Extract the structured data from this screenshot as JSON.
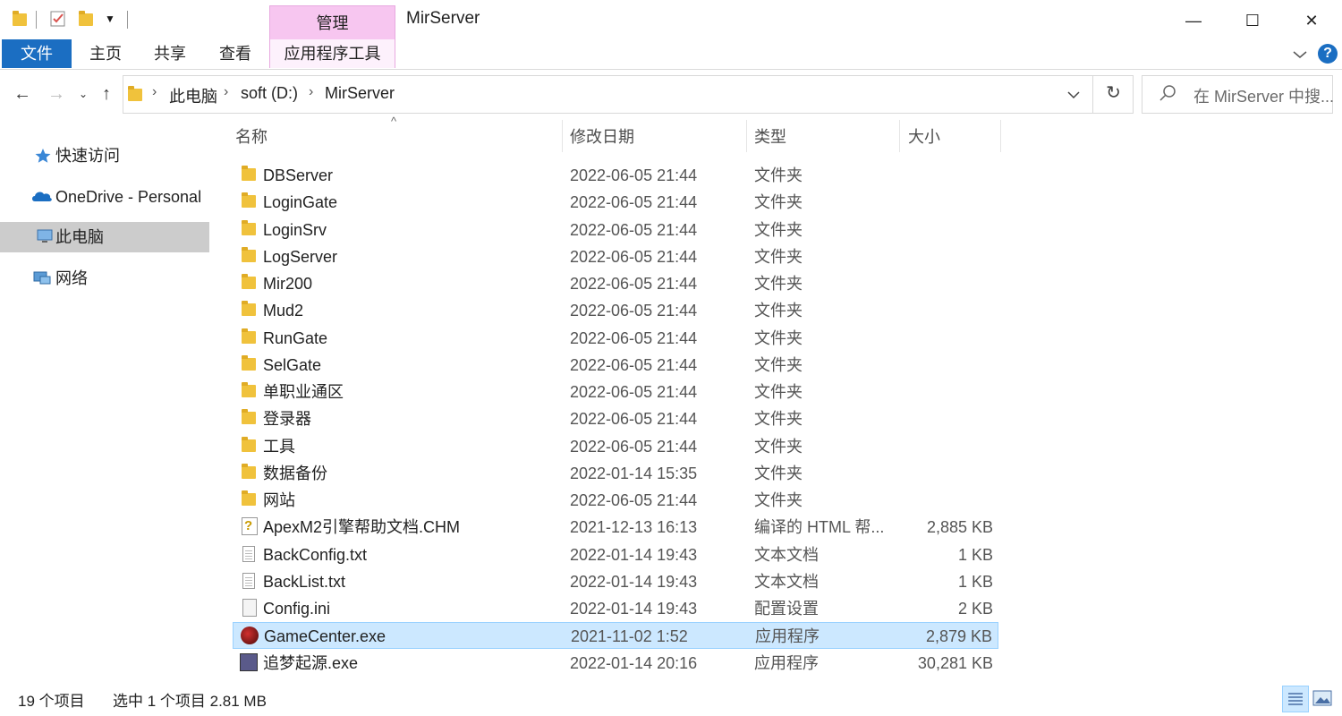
{
  "window": {
    "title": "MirServer",
    "manage_tab": "管理",
    "minimize": "—",
    "maximize": "☐",
    "close": "✕"
  },
  "ribbon": {
    "tabs": [
      "文件",
      "主页",
      "共享",
      "查看",
      "应用程序工具"
    ],
    "help": "?"
  },
  "address": {
    "crumbs": [
      "此电脑",
      "soft (D:)",
      "MirServer"
    ],
    "search_placeholder": "在 MirServer 中搜..."
  },
  "nav_pane": {
    "items": [
      "快速访问",
      "OneDrive - Personal",
      "此电脑",
      "网络"
    ],
    "selected_index": 2
  },
  "columns": {
    "name": "名称",
    "date": "修改日期",
    "type": "类型",
    "size": "大小"
  },
  "files": [
    {
      "name": "DBServer",
      "date": "2022-06-05 21:44",
      "type": "文件夹",
      "size": "",
      "icon": "folder-icon"
    },
    {
      "name": "LoginGate",
      "date": "2022-06-05 21:44",
      "type": "文件夹",
      "size": "",
      "icon": "folder-icon"
    },
    {
      "name": "LoginSrv",
      "date": "2022-06-05 21:44",
      "type": "文件夹",
      "size": "",
      "icon": "folder-icon"
    },
    {
      "name": "LogServer",
      "date": "2022-06-05 21:44",
      "type": "文件夹",
      "size": "",
      "icon": "folder-icon"
    },
    {
      "name": "Mir200",
      "date": "2022-06-05 21:44",
      "type": "文件夹",
      "size": "",
      "icon": "folder-icon"
    },
    {
      "name": "Mud2",
      "date": "2022-06-05 21:44",
      "type": "文件夹",
      "size": "",
      "icon": "folder-icon"
    },
    {
      "name": "RunGate",
      "date": "2022-06-05 21:44",
      "type": "文件夹",
      "size": "",
      "icon": "folder-icon"
    },
    {
      "name": "SelGate",
      "date": "2022-06-05 21:44",
      "type": "文件夹",
      "size": "",
      "icon": "folder-icon"
    },
    {
      "name": "单职业通区",
      "date": "2022-06-05 21:44",
      "type": "文件夹",
      "size": "",
      "icon": "folder-icon"
    },
    {
      "name": "登录器",
      "date": "2022-06-05 21:44",
      "type": "文件夹",
      "size": "",
      "icon": "folder-icon"
    },
    {
      "name": "工具",
      "date": "2022-06-05 21:44",
      "type": "文件夹",
      "size": "",
      "icon": "folder-icon"
    },
    {
      "name": "数据备份",
      "date": "2022-01-14 15:35",
      "type": "文件夹",
      "size": "",
      "icon": "folder-icon"
    },
    {
      "name": "网站",
      "date": "2022-06-05 21:44",
      "type": "文件夹",
      "size": "",
      "icon": "folder-icon"
    },
    {
      "name": "ApexM2引擎帮助文档.CHM",
      "date": "2021-12-13 16:13",
      "type": "编译的 HTML 帮...",
      "size": "2,885 KB",
      "icon": "chm-icon"
    },
    {
      "name": "BackConfig.txt",
      "date": "2022-01-14 19:43",
      "type": "文本文档",
      "size": "1 KB",
      "icon": "text-file-icon"
    },
    {
      "name": "BackList.txt",
      "date": "2022-01-14 19:43",
      "type": "文本文档",
      "size": "1 KB",
      "icon": "text-file-icon"
    },
    {
      "name": "Config.ini",
      "date": "2022-01-14 19:43",
      "type": "配置设置",
      "size": "2 KB",
      "icon": "ini-file-icon"
    },
    {
      "name": "GameCenter.exe",
      "date": "2021-11-02 1:52",
      "type": "应用程序",
      "size": "2,879 KB",
      "icon": "exe-icon"
    },
    {
      "name": "追梦起源.exe",
      "date": "2022-01-14 20:16",
      "type": "应用程序",
      "size": "30,281 KB",
      "icon": "exe-icon"
    }
  ],
  "selected_file_index": 17,
  "status": {
    "count": "19 个项目",
    "selection": "选中 1 个项目  2.81 MB"
  }
}
